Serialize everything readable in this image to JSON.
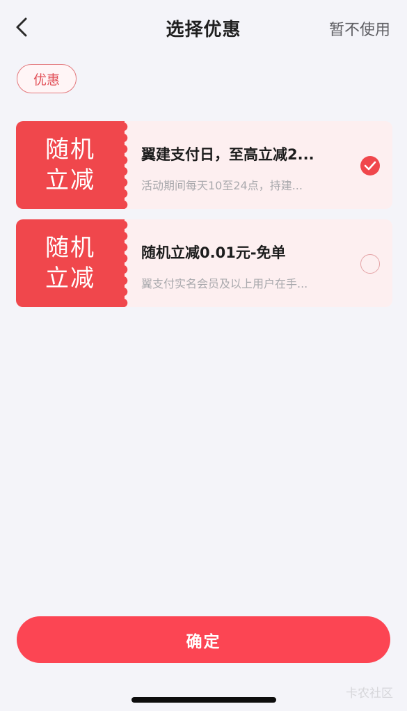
{
  "header": {
    "title": "选择优惠",
    "skip_label": "暂不使用",
    "back_icon": "chevron-left-icon"
  },
  "tag": {
    "label": "优惠"
  },
  "coupons": [
    {
      "stub_line1": "随机",
      "stub_line2": "立减",
      "name": "翼建支付日，至高立减2...",
      "desc": "活动期间每天10至24点，持建...",
      "selected": true
    },
    {
      "stub_line1": "随机",
      "stub_line2": "立减",
      "name": "随机立减0.01元-免单",
      "desc": "翼支付实名会员及以上用户在手...",
      "selected": false
    }
  ],
  "confirm": {
    "label": "确定"
  },
  "watermark": "卡农社区",
  "colors": {
    "accent": "#f0474c",
    "button": "#fc4553",
    "card_bg": "#fdeff0",
    "page_bg": "#f4f4f9"
  }
}
